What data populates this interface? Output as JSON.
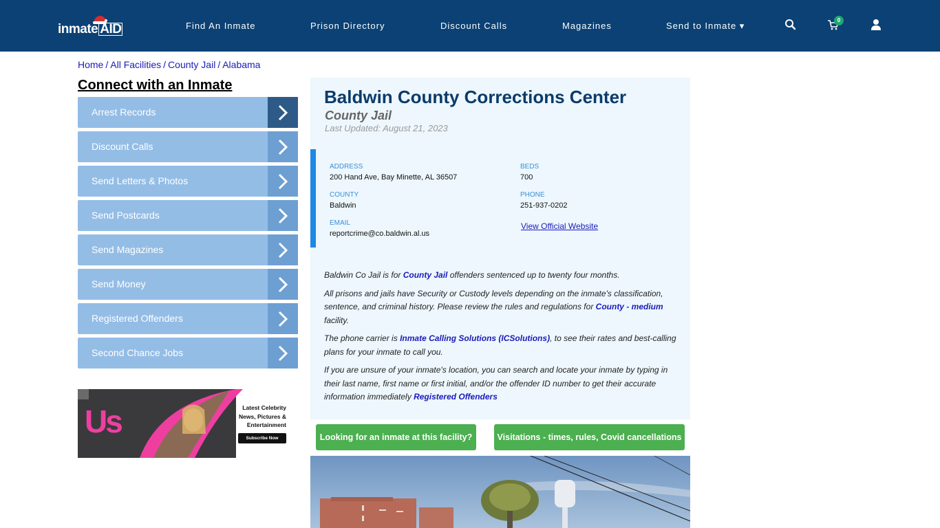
{
  "header": {
    "logo_text_main": "inmate",
    "logo_text_accent": "AID",
    "nav": [
      {
        "label": "Find An Inmate"
      },
      {
        "label": "Prison Directory"
      },
      {
        "label": "Discount Calls"
      },
      {
        "label": "Magazines"
      },
      {
        "label": "Send to Inmate ▾"
      }
    ],
    "icons": {
      "search": "search-icon",
      "cart": "cart-icon",
      "user": "user-icon"
    },
    "cart_count": "0"
  },
  "breadcrumb": [
    {
      "label": "Home"
    },
    {
      "label": "All Facilities"
    },
    {
      "label": "County Jail"
    },
    {
      "label": "Alabama"
    }
  ],
  "breadcrumb_separator": "/",
  "sidebar": {
    "title": "Connect with an Inmate",
    "items": [
      {
        "label": "Arrest Records"
      },
      {
        "label": "Discount Calls"
      },
      {
        "label": "Send Letters & Photos"
      },
      {
        "label": "Send Postcards"
      },
      {
        "label": "Send Magazines"
      },
      {
        "label": "Send Money"
      },
      {
        "label": "Registered Offenders"
      },
      {
        "label": "Second Chance Jobs"
      }
    ],
    "ad": {
      "brand": "Us",
      "text": "Latest Celebrity\nNews, Pictures &\nEntertainment",
      "button": "Subscribe Now"
    }
  },
  "facility": {
    "name": "Baldwin County Corrections Center",
    "type": "County Jail",
    "last_updated": "Last Updated: August 21, 2023",
    "fields": {
      "address": {
        "label": "ADDRESS",
        "value": "200 Hand Ave, Bay Minette, AL 36507"
      },
      "beds": {
        "label": "BEDS",
        "value": "700"
      },
      "county": {
        "label": "COUNTY",
        "value": "Baldwin"
      },
      "phone": {
        "label": "PHONE",
        "value": "251-937-0202"
      },
      "email": {
        "label": "EMAIL",
        "value": "reportcrime@co.baldwin.al.us"
      }
    },
    "website_link": "View Official Website",
    "description": {
      "p1_a": "Baldwin Co Jail is for ",
      "p1_link": "County Jail",
      "p1_b": " offenders sentenced up to twenty four months.",
      "p2_a": "All prisons and jails have Security or Custody levels depending on the inmate's classification, sentence, and criminal history. Please review the rules and regulations for ",
      "p2_link": "County - medium",
      "p2_b": " facility.",
      "p3_a": "The phone carrier is ",
      "p3_link": "Inmate Calling Solutions (ICSolutions)",
      "p3_b": ", to see their rates and best-calling plans for your inmate to call you.",
      "p4_a": "If you are unsure of your inmate's location, you can search and locate your inmate by typing in their last name, first name or first initial, and/or the offender ID number to get their accurate information immediately ",
      "p4_link": "Registered Offenders"
    }
  },
  "actions": {
    "find_inmate": "Looking for an inmate at this facility?",
    "visitations": "Visitations - times, rules, Covid cancellations"
  },
  "colors": {
    "navbar": "#0b4174",
    "sidebar_button": "#94bde6",
    "sidebar_arrow": "#6d9fd2",
    "sidebar_arrow_active": "#2e5a88",
    "panel_bg": "#edf7fd",
    "title": "#0b3b6b",
    "accent_bar": "#1e88e5",
    "green_button": "#4caf50",
    "link": "#1a1ab8"
  }
}
